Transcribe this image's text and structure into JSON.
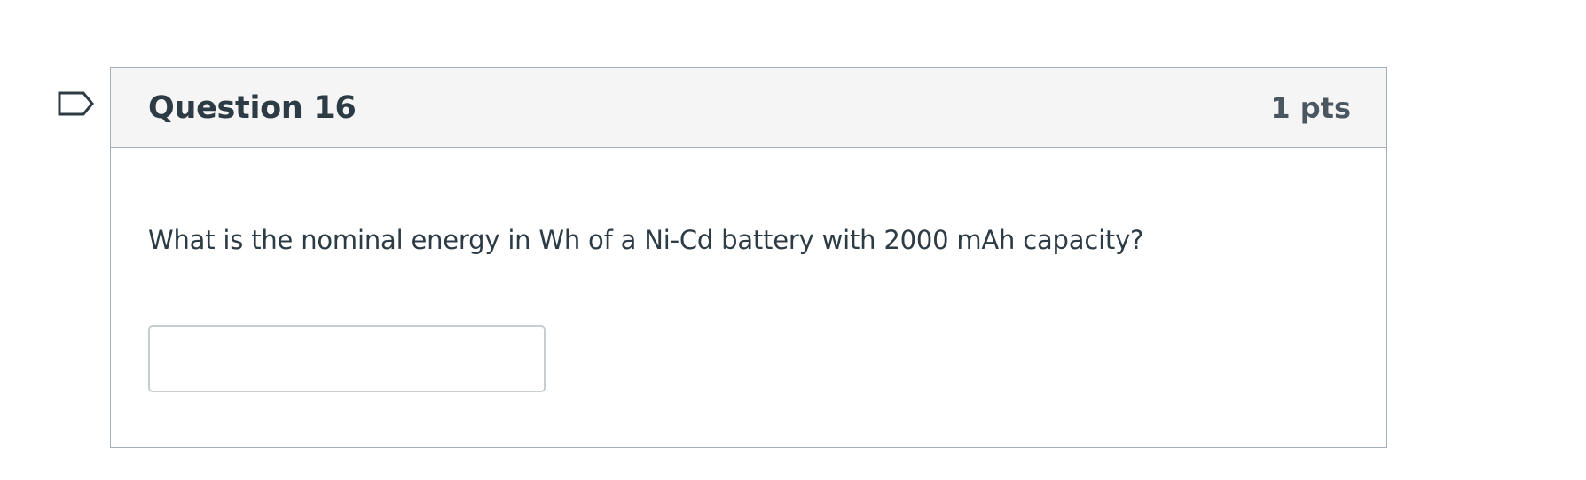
{
  "flag": {
    "icon": "flag-question-icon",
    "color": "#2d3b45"
  },
  "question": {
    "title": "Question 16",
    "points": "1 pts",
    "text": "What is the nominal energy in Wh of a Ni-Cd battery with 2000 mAh capacity?",
    "answer_value": "",
    "answer_placeholder": ""
  },
  "colors": {
    "header_bg": "#f5f5f5",
    "border": "#a5afb5",
    "text": "#2d3b45"
  }
}
